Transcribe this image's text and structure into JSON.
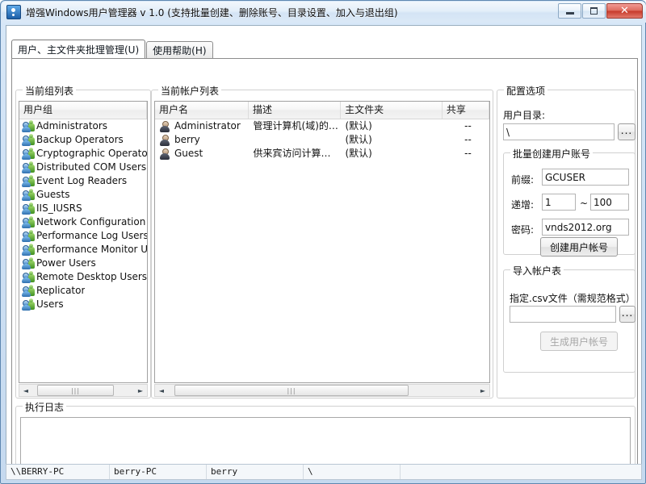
{
  "window": {
    "title": "增强Windows用户管理器 v 1.0 (支持批量创建、删除账号、目录设置、加入与退出组)",
    "icon": "app-icon",
    "buttons": {
      "minimize": "–",
      "maximize": "□",
      "close": "✕"
    }
  },
  "tabs": [
    {
      "label": "用户、主文件夹批理管理(U)",
      "accesskey": "U",
      "active": true
    },
    {
      "label": "使用帮助(H)",
      "accesskey": "H",
      "active": false
    }
  ],
  "groups_panel": {
    "title": "当前组列表",
    "column_header": "用户组",
    "items": [
      "Administrators",
      "Backup Operators",
      "Cryptographic Operators",
      "Distributed COM Users",
      "Event Log Readers",
      "Guests",
      "IIS_IUSRS",
      "Network Configuration Ope",
      "Performance Log Users",
      "Performance Monitor Users",
      "Power Users",
      "Remote Desktop Users",
      "Replicator",
      "Users"
    ],
    "scrollbar": {
      "left_arrow": "◄",
      "right_arrow": "►",
      "thumb_grip": "|||"
    }
  },
  "accounts_panel": {
    "title": "当前帐户列表",
    "columns": [
      "用户名",
      "描述",
      "主文件夹",
      "共享"
    ],
    "rows": [
      {
        "username": "Administrator",
        "description": "管理计算机(域)的…",
        "home_folder": "(默认)",
        "share": "--"
      },
      {
        "username": "berry",
        "description": "",
        "home_folder": "(默认)",
        "share": "--"
      },
      {
        "username": "Guest",
        "description": "供来宾访问计算…",
        "home_folder": "(默认)",
        "share": "--"
      }
    ],
    "scrollbar": {
      "left_arrow": "◄",
      "right_arrow": "►",
      "thumb_grip": "|||"
    }
  },
  "config_panel": {
    "title": "配置选项",
    "user_dir_label": "用户目录:",
    "user_dir_value": "\\",
    "user_dir_browse": "...",
    "batch_create": {
      "title": "批量创建用户账号",
      "prefix_label": "前缀:",
      "prefix_value": "GCUSER",
      "increment_label": "递增:",
      "increment_from": "1",
      "increment_sep": "~",
      "increment_to": "100",
      "password_label": "密码:",
      "password_value": "vnds2012.org",
      "create_button": "创建用户帐号"
    },
    "import_table": {
      "title": "导入帐户表",
      "csv_label": "指定.csv文件（需规范格式）",
      "csv_value": "",
      "csv_browse": "...",
      "generate_button": "生成用户帐号",
      "generate_disabled": true
    }
  },
  "log_panel": {
    "title": "执行日志",
    "content": ""
  },
  "statusbar": {
    "panels": [
      "\\\\BERRY-PC",
      "berry-PC",
      "berry",
      "\\",
      ""
    ]
  },
  "colors": {
    "frame": "#c5d9ef",
    "titlebar": "#e3eef9",
    "close_button": "#c6392a",
    "client": "#ffffff",
    "groupbox_border": "#d0d0d0"
  }
}
